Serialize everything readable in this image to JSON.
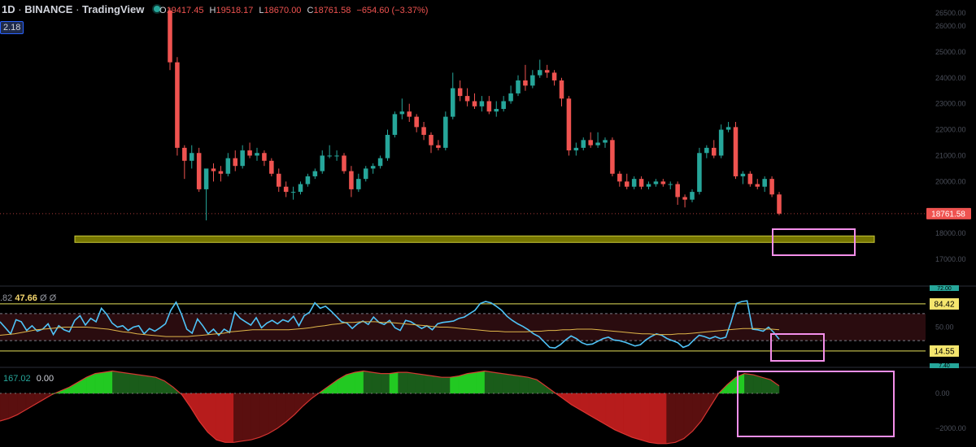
{
  "header": {
    "interval": "1D",
    "exchange": "BINANCE",
    "source": "TradingView",
    "open_label": "O",
    "open": "19417.45",
    "high_label": "H",
    "high": "19518.17",
    "low_label": "L",
    "low": "18670.00",
    "close_label": "C",
    "close": "18761.58",
    "change": "−654.60 (−3.37%)",
    "left_tag": "2.18"
  },
  "price_axis": {
    "ticks": [
      "26500.00",
      "26000.00",
      "25000.00",
      "24000.00",
      "23000.00",
      "22000.00",
      "21000.00",
      "20000.00",
      "18000.00",
      "17000.00"
    ],
    "last_price_label": "18761.58",
    "last_price": 18761.58
  },
  "rsi_panel": {
    "legend_prefix": ".82",
    "legend_value": "47.66",
    "legend_suffix": "Ø Ø",
    "axis_labels": [
      "84.42",
      "50.00",
      "14.55"
    ],
    "top_cut_label": "72.00",
    "bottom_cut_label": "7.40"
  },
  "wt_panel": {
    "legend_value": "167.02",
    "legend_value2": "0.00",
    "axis_labels": [
      "0.00",
      "−2000.00"
    ]
  },
  "colors": {
    "up": "#26a69a",
    "down": "#ef5350",
    "support_zone": "#8b8b00",
    "highlight_box": "#f48fea",
    "rsi_line": "#4fc3f7",
    "rsi_ma": "#e0b64a",
    "wt_pos_bright": "#22c922",
    "wt_pos_dark": "#1a5c1a",
    "wt_neg_bright": "#b71c1c",
    "wt_neg_dark": "#5a0f0f"
  },
  "chart_data": {
    "type": "candlestick",
    "main": {
      "price_min": 16800,
      "price_max": 26700,
      "support_zone": [
        17650,
        17900
      ],
      "candles": [
        [
          26600,
          26700,
          24300,
          24600
        ],
        [
          24600,
          24800,
          21000,
          21300
        ],
        [
          21300,
          21400,
          20100,
          20800
        ],
        [
          20800,
          21400,
          20500,
          21100
        ],
        [
          21100,
          21300,
          19600,
          19700
        ],
        [
          19700,
          20000,
          18500,
          20500
        ],
        [
          20500,
          20700,
          20000,
          20400
        ],
        [
          20400,
          20600,
          20000,
          20300
        ],
        [
          20300,
          21100,
          20200,
          20900
        ],
        [
          20900,
          21200,
          20400,
          20600
        ],
        [
          20600,
          21400,
          20500,
          21200
        ],
        [
          21200,
          21500,
          20900,
          21000
        ],
        [
          21000,
          21300,
          20800,
          21100
        ],
        [
          21100,
          21200,
          20600,
          20800
        ],
        [
          20800,
          20900,
          20200,
          20300
        ],
        [
          20300,
          20500,
          19600,
          19800
        ],
        [
          19800,
          20000,
          19400,
          19600
        ],
        [
          19600,
          19800,
          19300,
          19600
        ],
        [
          19600,
          20000,
          19500,
          19900
        ],
        [
          19900,
          20300,
          19800,
          20200
        ],
        [
          20200,
          20500,
          20100,
          20400
        ],
        [
          20400,
          21200,
          20300,
          21000
        ],
        [
          21000,
          21400,
          20900,
          21000
        ],
        [
          21000,
          21200,
          20800,
          21000
        ],
        [
          21000,
          21100,
          20300,
          20400
        ],
        [
          20400,
          20600,
          19400,
          19700
        ],
        [
          19700,
          20300,
          19600,
          20100
        ],
        [
          20100,
          20600,
          20000,
          20500
        ],
        [
          20500,
          20700,
          20300,
          20600
        ],
        [
          20600,
          21000,
          20500,
          20900
        ],
        [
          20900,
          22000,
          20800,
          21800
        ],
        [
          21800,
          22700,
          21700,
          22600
        ],
        [
          22600,
          23200,
          22400,
          22700
        ],
        [
          22700,
          23000,
          22300,
          22500
        ],
        [
          22500,
          22600,
          21900,
          22100
        ],
        [
          22100,
          22300,
          21600,
          21800
        ],
        [
          21800,
          21900,
          21100,
          21400
        ],
        [
          21400,
          21600,
          21200,
          21300
        ],
        [
          21300,
          22700,
          21200,
          22500
        ],
        [
          22500,
          24200,
          22400,
          23600
        ],
        [
          23600,
          23900,
          23100,
          23300
        ],
        [
          23300,
          23600,
          22900,
          23100
        ],
        [
          23100,
          23400,
          22800,
          22900
        ],
        [
          22900,
          23300,
          22700,
          23100
        ],
        [
          23100,
          23300,
          22600,
          22700
        ],
        [
          22700,
          23100,
          22500,
          22800
        ],
        [
          22800,
          23300,
          22700,
          23100
        ],
        [
          23100,
          23700,
          23000,
          23400
        ],
        [
          23400,
          24100,
          23300,
          23900
        ],
        [
          23900,
          24500,
          23500,
          23700
        ],
        [
          23700,
          24300,
          23600,
          24100
        ],
        [
          24100,
          24700,
          24000,
          24300
        ],
        [
          24300,
          24500,
          24000,
          24200
        ],
        [
          24200,
          24300,
          23700,
          23900
        ],
        [
          23900,
          24000,
          22900,
          23200
        ],
        [
          23200,
          23300,
          21000,
          21200
        ],
        [
          21200,
          21500,
          21000,
          21300
        ],
        [
          21300,
          21700,
          21200,
          21600
        ],
        [
          21600,
          21900,
          21300,
          21400
        ],
        [
          21400,
          21900,
          21300,
          21500
        ],
        [
          21500,
          21700,
          21300,
          21600
        ],
        [
          21600,
          21700,
          20200,
          20300
        ],
        [
          20300,
          20400,
          19800,
          20000
        ],
        [
          20000,
          20300,
          19700,
          19800
        ],
        [
          19800,
          20200,
          19700,
          20100
        ],
        [
          20100,
          20200,
          19700,
          19800
        ],
        [
          19800,
          20000,
          19700,
          19900
        ],
        [
          19900,
          20100,
          19800,
          20000
        ],
        [
          20000,
          20100,
          19800,
          19900
        ],
        [
          19900,
          20000,
          19700,
          19900
        ],
        [
          19900,
          20000,
          19100,
          19400
        ],
        [
          19400,
          19500,
          19000,
          19300
        ],
        [
          19300,
          19700,
          19200,
          19600
        ],
        [
          19600,
          21300,
          19500,
          21100
        ],
        [
          21100,
          21400,
          20900,
          21300
        ],
        [
          21300,
          21600,
          20900,
          21000
        ],
        [
          21000,
          22200,
          20900,
          22000
        ],
        [
          22000,
          22300,
          21900,
          22100
        ],
        [
          22100,
          22300,
          20100,
          20200
        ],
        [
          20200,
          20400,
          19900,
          20300
        ],
        [
          20300,
          20400,
          19800,
          19900
        ],
        [
          19900,
          20100,
          19700,
          19800
        ],
        [
          19800,
          20200,
          19600,
          20100
        ],
        [
          20100,
          20200,
          19400,
          19500
        ],
        [
          19500,
          19600,
          18700,
          18761.58
        ]
      ]
    },
    "rsi": {
      "upper_band": 84.42,
      "mid": 50,
      "lower_band": 14.55,
      "upper_dash": 70,
      "lower_dash": 30,
      "values": [
        58,
        49,
        40,
        61,
        58,
        45,
        52,
        44,
        47,
        55,
        39,
        52,
        46,
        43,
        60,
        67,
        53,
        63,
        58,
        78,
        69,
        56,
        50,
        52,
        45,
        50,
        52,
        40,
        48,
        44,
        49,
        55,
        75,
        87,
        69,
        47,
        41,
        62,
        52,
        40,
        47,
        38,
        47,
        42,
        72,
        63,
        58,
        53,
        64,
        49,
        56,
        60,
        55,
        61,
        58,
        66,
        52,
        67,
        72,
        86,
        78,
        81,
        74,
        66,
        58,
        56,
        48,
        55,
        59,
        54,
        65,
        57,
        54,
        60,
        49,
        45,
        60,
        58,
        53,
        48,
        52,
        46,
        55,
        57,
        58,
        59,
        63,
        65,
        70,
        75,
        85,
        88,
        86,
        81,
        75,
        66,
        60,
        55,
        51,
        46,
        40,
        36,
        28,
        20,
        19,
        24,
        31,
        37,
        33,
        27,
        24,
        25,
        29,
        33,
        35,
        31,
        30,
        28,
        25,
        22,
        24,
        31,
        36,
        40,
        38,
        33,
        30,
        27,
        20,
        23,
        31,
        38,
        36,
        33,
        36,
        33,
        35,
        58,
        85,
        88,
        89,
        47,
        46,
        44,
        50,
        42,
        32
      ],
      "ma_values": [
        38,
        39,
        40,
        42,
        44,
        46,
        47,
        48,
        49,
        50,
        50,
        50,
        50,
        49,
        48,
        47,
        45,
        43,
        42,
        40,
        39,
        38,
        37,
        36,
        36,
        36,
        36,
        37,
        38,
        39,
        40,
        41,
        43,
        44,
        45,
        46,
        46,
        46,
        46,
        46,
        46,
        47,
        48,
        49,
        51,
        52,
        54,
        55,
        57,
        57,
        58,
        58,
        58,
        57,
        57,
        56,
        55,
        54,
        53,
        52,
        51,
        50,
        50,
        49,
        48,
        47,
        46,
        45,
        44,
        44,
        43,
        43,
        43,
        43,
        44,
        44,
        45,
        45,
        46,
        46,
        47,
        47,
        47,
        46,
        45,
        44,
        43,
        42,
        41,
        40,
        40,
        39,
        39,
        39,
        40,
        40,
        41,
        42,
        43,
        44,
        45,
        46,
        47,
        48,
        48,
        48,
        47,
        47,
        46
      ]
    },
    "wave": {
      "zero": 0,
      "min": -2200,
      "max": 950,
      "values": [
        -1100,
        -1000,
        -850,
        -650,
        -450,
        -250,
        -50,
        100,
        250,
        450,
        650,
        800,
        850,
        900,
        850,
        800,
        750,
        700,
        650,
        500,
        250,
        -50,
        -550,
        -1100,
        -1550,
        -1850,
        -1950,
        -1950,
        -1900,
        -1850,
        -1750,
        -1600,
        -1400,
        -1150,
        -850,
        -500,
        -200,
        50,
        300,
        550,
        750,
        850,
        900,
        850,
        800,
        800,
        850,
        850,
        800,
        750,
        700,
        650,
        650,
        700,
        800,
        850,
        900,
        850,
        800,
        750,
        700,
        650,
        550,
        300,
        50,
        -200,
        -450,
        -650,
        -850,
        -1050,
        -1250,
        -1450,
        -1600,
        -1750,
        -1850,
        -1950,
        -2000,
        -2000,
        -1950,
        -1800,
        -1500,
        -1100,
        -550,
        0,
        350,
        650,
        800,
        750,
        650,
        550,
        300
      ]
    }
  }
}
